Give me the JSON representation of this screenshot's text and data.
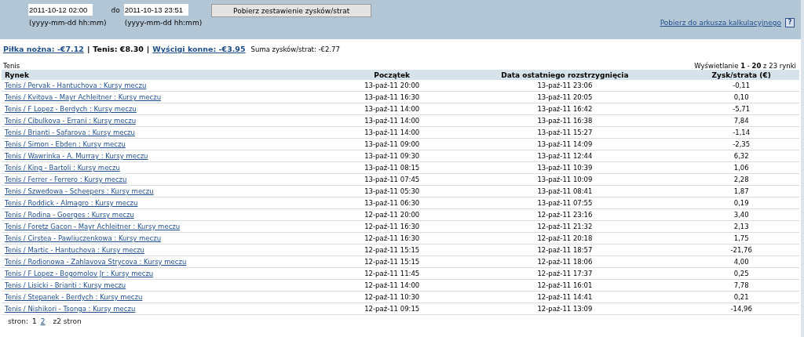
{
  "filter": {
    "from": "2011-10-12 02:00",
    "to_label": "do",
    "to": "2011-10-13 23:51",
    "from_hint": "(yyyy-mm-dd hh:mm)",
    "to_hint": "(yyyy-mm-dd hh:mm)",
    "button": "Pobierz zestawienie zysków/strat",
    "export_link": "Pobierz do arkusza kalkulacyjnego",
    "help": "?"
  },
  "summary": [
    {
      "kind": "link",
      "text": "Piłka nożna: -€7.12"
    },
    {
      "kind": "separator",
      "text": "|"
    },
    {
      "kind": "current",
      "text": "Tenis: €8.30"
    },
    {
      "kind": "separator",
      "text": "|"
    },
    {
      "kind": "link",
      "text": "Wyścigi konne: -€3.95"
    },
    {
      "kind": "total",
      "text": "Suma zysków/strat:  -€2.77"
    }
  ],
  "section_title": "Tenis",
  "range": "Wyświetlanie **1** - **20** z 23 rynki",
  "table": {
    "columns": [
      "Rynek",
      "Początek",
      "Data ostatniego rozstrzygnięcia",
      "Zysk/strata (€)"
    ],
    "rows": [
      [
        "Tenis / Pervak - Hantuchova : Kursy meczu",
        "13-paź-11 20:00",
        "13-paź-11 23:06",
        "-0,11"
      ],
      [
        "Tenis / Kvitova - Mayr Achleitner : Kursy meczu",
        "13-paź-11 16:30",
        "13-paź-11 20:05",
        "0,10"
      ],
      [
        "Tenis / F Lopez - Berdych : Kursy meczu",
        "13-paź-11 14:00",
        "13-paź-11 16:42",
        "-5,71"
      ],
      [
        "Tenis / Cibulkova - Errani : Kursy meczu",
        "13-paź-11 14:00",
        "13-paź-11 16:38",
        "7,84"
      ],
      [
        "Tenis / Brianti - Safarova : Kursy meczu",
        "13-paź-11 14:00",
        "13-paź-11 15:27",
        "-1,14"
      ],
      [
        "Tenis / Simon - Ebden : Kursy meczu",
        "13-paź-11 09:00",
        "13-paź-11 14:09",
        "-2,35"
      ],
      [
        "Tenis / Wawrinka - A. Murray : Kursy meczu",
        "13-paź-11 09:30",
        "13-paź-11 12:44",
        "6,32"
      ],
      [
        "Tenis / King - Bartoli : Kursy meczu",
        "13-paź-11 08:15",
        "13-paź-11 10:39",
        "1,06"
      ],
      [
        "Tenis / Ferrer - Ferrero : Kursy meczu",
        "13-paź-11 07:45",
        "13-paź-11 10:09",
        "2,28"
      ],
      [
        "Tenis / Szwedowa - Scheepers : Kursy meczu",
        "13-paź-11 05:30",
        "13-paź-11 08:41",
        "1,87"
      ],
      [
        "Tenis / Roddick - Almagro : Kursy meczu",
        "13-paź-11 06:30",
        "13-paź-11 07:55",
        "0,19"
      ],
      [
        "Tenis / Rodina - Goerges : Kursy meczu",
        "12-paź-11 20:00",
        "12-paź-11 23:16",
        "3,40"
      ],
      [
        "Tenis / Foretz Gacon - Mayr Achleitner : Kursy meczu",
        "12-paź-11 16:30",
        "12-paź-11 21:32",
        "2,13"
      ],
      [
        "Tenis / Cirstea - Pawliuczenkowa : Kursy meczu",
        "12-paź-11 16:30",
        "12-paź-11 20:18",
        "1,75"
      ],
      [
        "Tenis / Martic - Hantuchova : Kursy meczu",
        "12-paź-11 15:15",
        "12-paź-11 18:57",
        "-21,76"
      ],
      [
        "Tenis / Rodionowa - Zahlavova Strycova : Kursy meczu",
        "12-paź-11 15:15",
        "12-paź-11 18:06",
        "4,00"
      ],
      [
        "Tenis / F Lopez - Bogomolov Jr : Kursy meczu",
        "12-paź-11 11:45",
        "12-paź-11 17:37",
        "0,25"
      ],
      [
        "Tenis / Lisicki - Brianti : Kursy meczu",
        "12-paź-11 14:00",
        "12-paź-11 16:01",
        "7,78"
      ],
      [
        "Tenis / Stepanek - Berdych : Kursy meczu",
        "12-paź-11 10:30",
        "12-paź-11 14:41",
        "0,21"
      ],
      [
        "Tenis / Nishikori - Tsonga : Kursy meczu",
        "12-paź-11 09:15",
        "12-paź-11 13:09",
        "-14,96"
      ]
    ]
  },
  "pager": {
    "label": "stron:",
    "pages": [
      {
        "text": "1",
        "selected": true
      },
      {
        "text": "2",
        "selected": false
      }
    ],
    "total": "z2 stron"
  }
}
